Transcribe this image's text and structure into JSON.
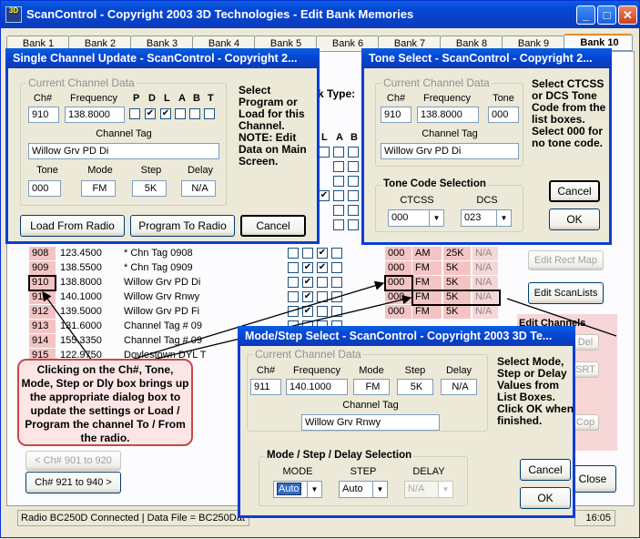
{
  "window": {
    "title": "ScanControl - Copyright 2003 3D Technologies - Edit Bank Memories",
    "icon_text": "3D"
  },
  "tabs": [
    "Bank 1",
    "Bank 2",
    "Bank 3",
    "Bank 4",
    "Bank 5",
    "Bank 6",
    "Bank 7",
    "Bank 8",
    "Bank 9",
    "Bank 10"
  ],
  "bank_type_label": "k Type:",
  "grid_headers": {
    "L": "L",
    "A": "A",
    "B": "B"
  },
  "rows": [
    {
      "ch": "908",
      "freq": "123.4500",
      "tag": "* Chn Tag 0908",
      "tone": "000",
      "mode": "AM",
      "step": "25K",
      "delay": "N/A",
      "checks": [
        false,
        true,
        false
      ]
    },
    {
      "ch": "909",
      "freq": "138.5500",
      "tag": "* Chn Tag 0909",
      "tone": "000",
      "mode": "FM",
      "step": "5K",
      "delay": "N/A",
      "checks": [
        true,
        true,
        false
      ]
    },
    {
      "ch": "910",
      "freq": "138.8000",
      "tag": "Willow Grv PD Di",
      "tone": "000",
      "mode": "FM",
      "step": "5K",
      "delay": "N/A",
      "checks": [
        true,
        false,
        false
      ]
    },
    {
      "ch": "911",
      "freq": "140.1000",
      "tag": "Willow Grv Rnwy",
      "tone": "000",
      "mode": "FM",
      "step": "5K",
      "delay": "N/A",
      "checks": [
        true,
        false,
        false
      ]
    },
    {
      "ch": "912",
      "freq": "139.5000",
      "tag": "Willow Grv PD Fi",
      "tone": "000",
      "mode": "FM",
      "step": "5K",
      "delay": "N/A",
      "checks": [
        true,
        false,
        false
      ]
    },
    {
      "ch": "913",
      "freq": "131.6000",
      "tag": "Channel Tag # 09",
      "tone": "",
      "mode": "",
      "step": "",
      "delay": "",
      "checks": [
        false,
        false,
        false
      ]
    },
    {
      "ch": "914",
      "freq": "155.3350",
      "tag": "Channel Tag # 09",
      "tone": "",
      "mode": "",
      "step": "",
      "delay": "",
      "checks": [
        false,
        false,
        false
      ]
    },
    {
      "ch": "915",
      "freq": "122.9750",
      "tag": "Doylestown DYL T",
      "tone": "",
      "mode": "",
      "step": "",
      "delay": "",
      "checks": [
        false,
        false,
        false
      ]
    }
  ],
  "side_buttons": {
    "edit_rect_map": "Edit Rect Map",
    "edit_scan_lists": "Edit ScanLists",
    "edit_channels": "Edit Channels",
    "del": "Del",
    "ins": "SRT",
    "cop": "Cop",
    "close": "Close"
  },
  "nav": {
    "prev": "< Ch# 901 to 920",
    "next": "Ch# 921 to 940 >"
  },
  "status": {
    "text": "Radio BC250D Connected | Data File = BC250Dat",
    "time": "16:05"
  },
  "callout": "Clicking on the Ch#, Tone, Mode, Step or Dly box brings up the appropriate dialog box to update the settings or Load / Program the channel To / From the radio.",
  "single_dialog": {
    "title": "Single Channel Update - ScanControl - Copyright 2...",
    "group": "Current Channel Data",
    "labels": {
      "ch": "Ch#",
      "freq": "Frequency",
      "p": "P",
      "d": "D",
      "l": "L",
      "a": "A",
      "b": "B",
      "t": "T",
      "tag": "Channel Tag",
      "tone": "Tone",
      "mode": "Mode",
      "step": "Step",
      "delay": "Delay"
    },
    "values": {
      "ch": "910",
      "freq": "138.8000",
      "tag": "Willow Grv PD Di",
      "tone": "000",
      "mode": "FM",
      "step": "5K",
      "delay": "N/A"
    },
    "flags": [
      false,
      true,
      true,
      false,
      false,
      false
    ],
    "info": "Select Program or Load for this Channel. NOTE: Edit Data on Main Screen.",
    "buttons": {
      "load": "Load From Radio",
      "program": "Program To Radio",
      "cancel": "Cancel"
    }
  },
  "tone_dialog": {
    "title": "Tone Select - ScanControl - Copyright 2...",
    "group": "Current Channel Data",
    "labels": {
      "ch": "Ch#",
      "freq": "Frequency",
      "tone": "Tone",
      "tag": "Channel Tag"
    },
    "values": {
      "ch": "910",
      "freq": "138.8000",
      "tone": "000",
      "tag": "Willow Grv PD Di"
    },
    "info": "Select CTCSS or DCS Tone Code from the list boxes. Select 000 for no tone code.",
    "selection_group": "Tone Code Selection",
    "ctcss_label": "CTCSS",
    "dcs_label": "DCS",
    "ctcss_value": "000",
    "dcs_value": "023",
    "buttons": {
      "cancel": "Cancel",
      "ok": "OK"
    }
  },
  "mode_dialog": {
    "title": "Mode/Step Select - ScanControl - Copyright 2003 3D Te...",
    "group": "Current Channel Data",
    "labels": {
      "ch": "Ch#",
      "freq": "Frequency",
      "mode": "Mode",
      "step": "Step",
      "delay": "Delay",
      "tag": "Channel Tag"
    },
    "values": {
      "ch": "911",
      "freq": "140.1000",
      "mode": "FM",
      "step": "5K",
      "delay": "N/A",
      "tag": "Willow Grv Rnwy"
    },
    "info": "Select Mode, Step or Delay Values from List Boxes. Click OK when finished.",
    "selection_group": "Mode / Step / Delay Selection",
    "mode_label": "MODE",
    "step_label": "STEP",
    "delay_label": "DELAY",
    "mode_value": "Auto",
    "step_value": "Auto",
    "delay_value": "N/A",
    "buttons": {
      "cancel": "Cancel",
      "ok": "OK"
    }
  }
}
